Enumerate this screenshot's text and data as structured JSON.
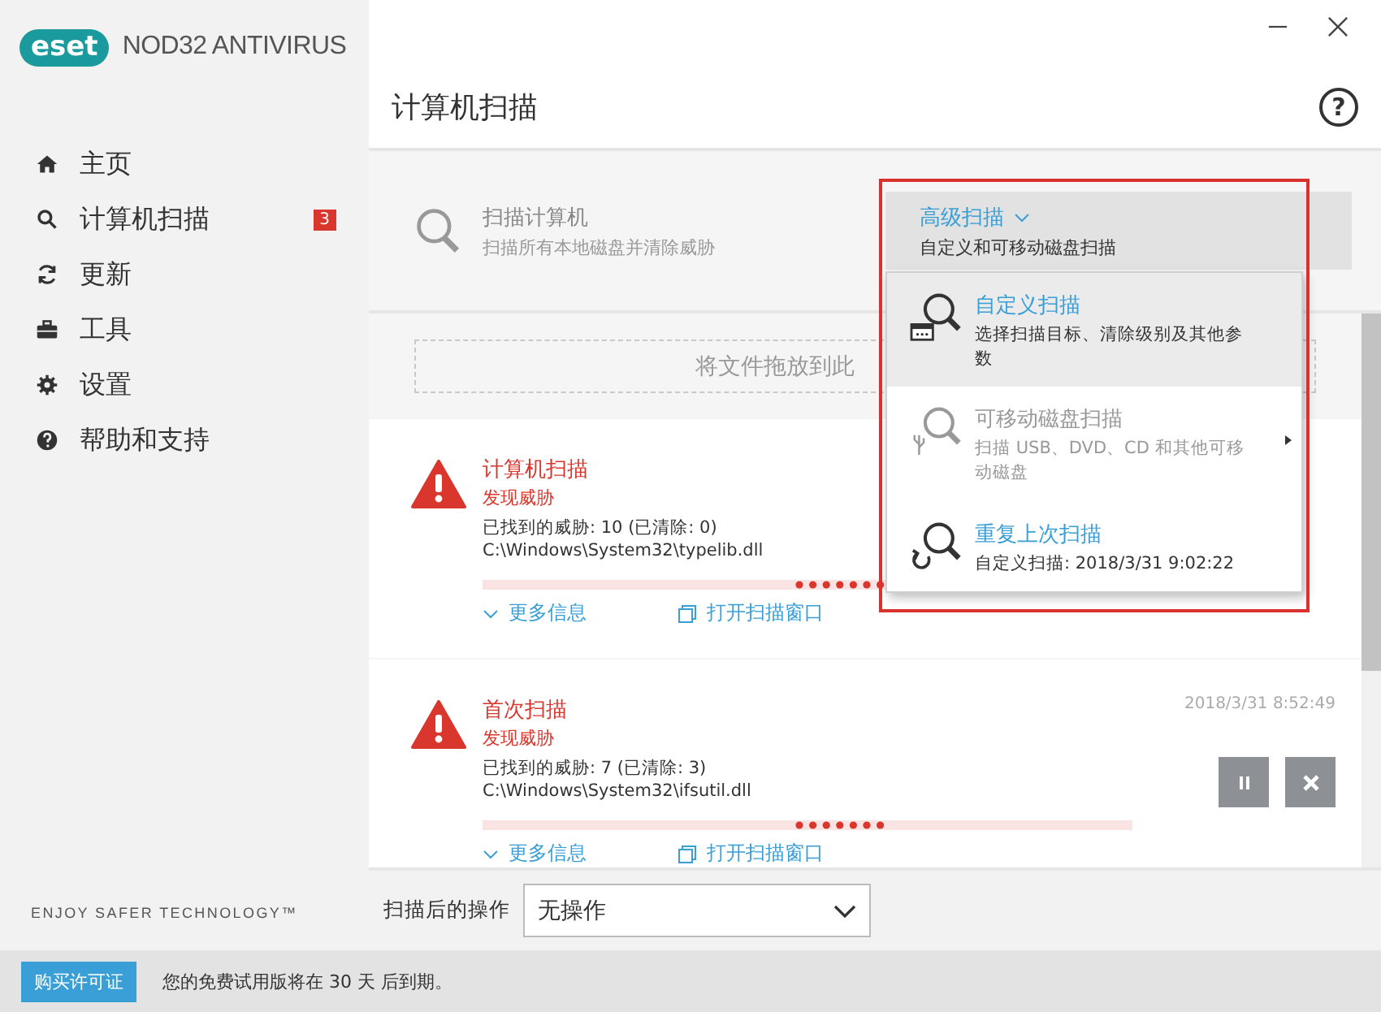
{
  "app": {
    "logo": "eset",
    "product": "NOD32 ANTIVIRUS"
  },
  "sidebar": {
    "items": [
      {
        "label": "主页"
      },
      {
        "label": "计算机扫描",
        "badge": "3"
      },
      {
        "label": "更新"
      },
      {
        "label": "工具"
      },
      {
        "label": "设置"
      },
      {
        "label": "帮助和支持"
      }
    ],
    "tagline": "ENJOY SAFER TECHNOLOGY™"
  },
  "page": {
    "title": "计算机扫描",
    "help": "?"
  },
  "scan_options": [
    {
      "kind": "scan",
      "title": "扫描计算机",
      "subtitle": "扫描所有本地磁盘并清除威胁",
      "highlighted": false
    },
    {
      "kind": "menu",
      "title": "高级扫描",
      "subtitle": "自定义和可移动磁盘扫描",
      "highlighted": true
    }
  ],
  "dropdown_menu": [
    {
      "kind": "custom",
      "title": "自定义扫描",
      "description": "选择扫描目标、清除级别及其他参数",
      "highlighted": true,
      "disabled": false,
      "submenu": false
    },
    {
      "kind": "removable",
      "title": "可移动磁盘扫描",
      "description": "扫描 USB、DVD、CD 和其他可移动磁盘",
      "highlighted": false,
      "disabled": true,
      "submenu": true
    },
    {
      "kind": "repeat",
      "title": "重复上次扫描",
      "description": "自定义扫描: 2018/3/31 9:02:22",
      "highlighted": false,
      "disabled": false,
      "submenu": false
    }
  ],
  "drop_zone": {
    "text": "将文件拖放到此"
  },
  "scans": [
    {
      "title": "计算机扫描",
      "status": "发现威胁",
      "threats": "已找到的威胁: 10 (已清除: 0)",
      "file": "C:\\Windows\\System32\\typelib.dll",
      "more": "更多信息",
      "open": "打开扫描窗口",
      "controls": false
    },
    {
      "title": "首次扫描",
      "status": "发现威胁",
      "date": "2018/3/31 8:52:49",
      "threats": "已找到的威胁: 7 (已清除: 3)",
      "file": "C:\\Windows\\System32\\ifsutil.dll",
      "more": "更多信息",
      "open": "打开扫描窗口",
      "controls": true
    }
  ],
  "after_scan": {
    "label": "扫描后的操作",
    "value": "无操作"
  },
  "status_bar": {
    "button": "购买许可证",
    "message": "您的免费试用版将在 30 天 后到期。"
  }
}
